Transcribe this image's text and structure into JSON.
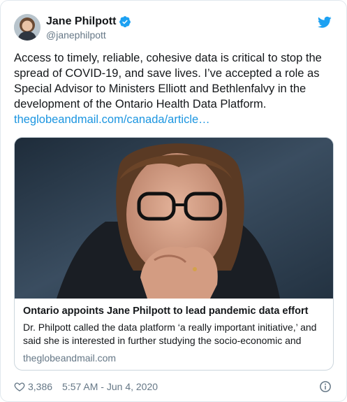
{
  "author": {
    "display_name": "Jane Philpott",
    "handle": "@janephilpott",
    "verified": true
  },
  "tweet": {
    "text": "Access to timely, reliable, cohesive data is critical to stop the spread of COVID-19, and save lives. I’ve accepted a role as Special Advisor to Ministers Elliott and Bethlenfalvy in the development of the Ontario Health Data Platform.",
    "link_text": "theglobeandmail.com/canada/article…"
  },
  "card": {
    "title": "Ontario appoints Jane Philpott to lead pandemic data effort",
    "description": "Dr. Philpott called the data platform ‘a really important initiative,’ and said she is interested in further studying the socio-economic and",
    "domain": "theglobeandmail.com"
  },
  "footer": {
    "likes": "3,386",
    "timestamp": "5:57 AM - Jun 4, 2020"
  },
  "icons": {
    "brand": "twitter-bird-icon",
    "verified": "verified-badge-icon",
    "like": "heart-icon",
    "info": "info-icon"
  },
  "colors": {
    "accent": "#1da1f2",
    "link": "#1b95e0",
    "secondary_text": "#657786",
    "border": "#e1e8ed"
  }
}
